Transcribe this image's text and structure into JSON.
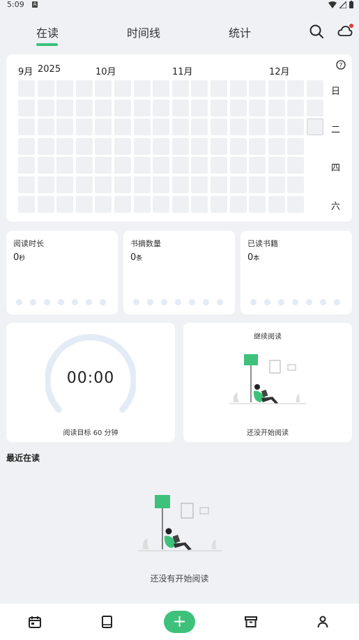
{
  "status_bar": {
    "time": "5:09",
    "notification_letter": "A"
  },
  "tabs": [
    {
      "label": "在读",
      "active": true
    },
    {
      "label": "时间线",
      "active": false
    },
    {
      "label": "统计",
      "active": false
    }
  ],
  "accent_color": "#3ec17a",
  "heatmap": {
    "months": [
      "9月",
      "2025",
      "10月",
      "11月",
      "12月"
    ],
    "weekdays": [
      "日",
      "二",
      "四",
      "六"
    ],
    "weeks": 16,
    "days": 7,
    "today_week": 15,
    "today_day": 2,
    "filled_days_last_week": 3
  },
  "stats": [
    {
      "title": "阅读时长",
      "value": "0",
      "unit": "秒"
    },
    {
      "title": "书摘数量",
      "value": "0",
      "unit": "条"
    },
    {
      "title": "已读书籍",
      "value": "0",
      "unit": "本"
    }
  ],
  "timer": {
    "display": "00:00",
    "goal_label": "阅读目标 60 分钟",
    "progress": 0
  },
  "continue_reading": {
    "title": "继续阅读",
    "empty_label": "还没开始阅读"
  },
  "recent": {
    "title": "最近在读",
    "empty_label": "还没有开始阅读"
  },
  "icons": {
    "search": "search-icon",
    "cloud": "cloud-icon",
    "help": "help-icon",
    "calendar": "calendar-icon",
    "book": "book-icon",
    "add": "+",
    "archive": "archive-icon",
    "profile": "person-icon"
  }
}
